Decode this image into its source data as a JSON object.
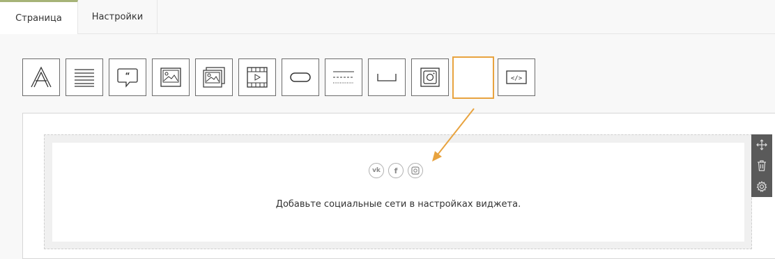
{
  "tabs": [
    {
      "label": "Страница",
      "active": true
    },
    {
      "label": "Настройки",
      "active": false
    }
  ],
  "toolbar": {
    "tools": [
      {
        "icon": "text-icon"
      },
      {
        "icon": "paragraph-icon"
      },
      {
        "icon": "quote-icon"
      },
      {
        "icon": "image-icon"
      },
      {
        "icon": "gallery-icon"
      },
      {
        "icon": "video-icon"
      },
      {
        "icon": "button-icon"
      },
      {
        "icon": "divider-icon"
      },
      {
        "icon": "spacer-icon"
      },
      {
        "icon": "instagram-icon"
      },
      {
        "icon": "social-icon",
        "selected": true
      },
      {
        "icon": "code-icon"
      }
    ]
  },
  "widget": {
    "social_icons": [
      "vk-icon",
      "facebook-icon",
      "instagram-icon"
    ],
    "social_labels": [
      "vk",
      "f",
      ""
    ],
    "hint": "Добавьте социальные сети в настройках виджета."
  },
  "colors": {
    "accent": "#e8a33f",
    "tab_indicator": "#a6b377",
    "side_panel": "#5a5a5a"
  }
}
